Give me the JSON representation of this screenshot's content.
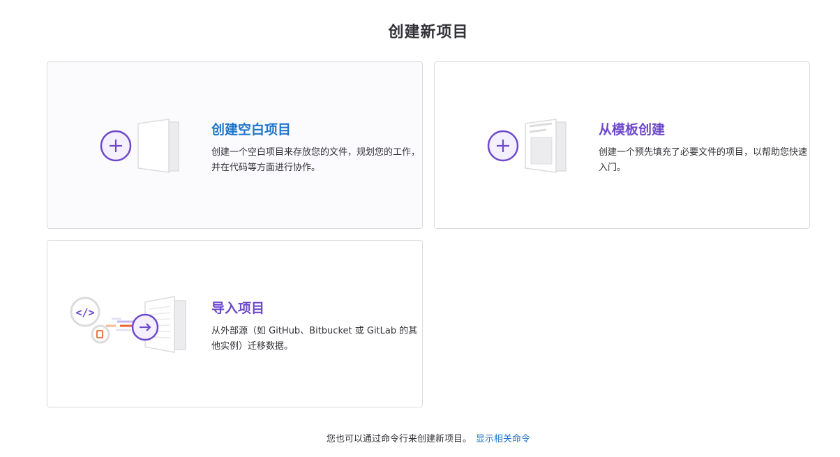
{
  "page": {
    "title": "创建新项目"
  },
  "cards": {
    "blank": {
      "title": "创建空白项目",
      "description": "创建一个空白项目来存放您的文件，规划您的工作，并在代码等方面进行协作。"
    },
    "template": {
      "title": "从模板创建",
      "description": "创建一个预先填充了必要文件的项目，以帮助您快速入门。"
    },
    "import": {
      "title": "导入项目",
      "description": "从外部源（如 GitHub、Bitbucket 或 GitLab 的其他实例）迁移数据。"
    }
  },
  "footer": {
    "text": "您也可以通过命令行来创建新项目。",
    "link_label": "显示相关命令"
  },
  "colors": {
    "accent_purple": "#6e49cb",
    "link_blue": "#1f75cb",
    "border": "#dcdcde",
    "text": "#333238"
  }
}
